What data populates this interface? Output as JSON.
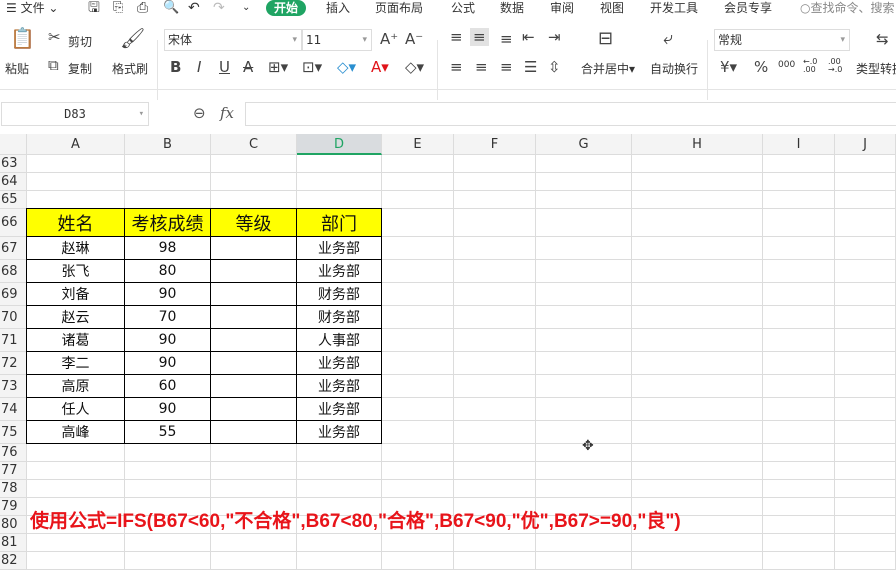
{
  "menubar": {
    "file": "文件",
    "tabs": [
      "开始",
      "插入",
      "页面布局",
      "公式",
      "数据",
      "审阅",
      "视图",
      "开发工具",
      "会员专享"
    ],
    "search_placeholder": "查找命令、搜索"
  },
  "ribbon": {
    "paste": "粘贴",
    "cut": "剪切",
    "copy": "复制",
    "format_painter": "格式刷",
    "font_name": "宋体",
    "font_size": "11",
    "merge_center": "合并居中",
    "wrap_text": "自动换行",
    "number_format": "常规",
    "type_convert": "类型转换",
    "currency": "¥",
    "percent": "%",
    "thousands": "000",
    "inc_decimal": "←.0 .00",
    "dec_decimal": ".00 →.0"
  },
  "formula_bar": {
    "cell_ref": "D83",
    "fx": "fx",
    "value": ""
  },
  "columns": [
    "A",
    "B",
    "C",
    "D",
    "E",
    "F",
    "G",
    "H",
    "I",
    "J"
  ],
  "selected_column": "D",
  "rows": [
    "63",
    "64",
    "65",
    "66",
    "67",
    "68",
    "69",
    "70",
    "71",
    "72",
    "73",
    "74",
    "75",
    "76",
    "77",
    "78",
    "79",
    "80",
    "81",
    "82"
  ],
  "table": {
    "headers": [
      "姓名",
      "考核成绩",
      "等级",
      "部门"
    ],
    "data": [
      [
        "赵琳",
        "98",
        "",
        "业务部"
      ],
      [
        "张飞",
        "80",
        "",
        "业务部"
      ],
      [
        "刘备",
        "90",
        "",
        "财务部"
      ],
      [
        "赵云",
        "70",
        "",
        "财务部"
      ],
      [
        "诸葛",
        "90",
        "",
        "人事部"
      ],
      [
        "李二",
        "90",
        "",
        "业务部"
      ],
      [
        "高原",
        "60",
        "",
        "业务部"
      ],
      [
        "任人",
        "90",
        "",
        "业务部"
      ],
      [
        "高峰",
        "55",
        "",
        "业务部"
      ]
    ]
  },
  "annotation": "使用公式=IFS(B67<60,\"不合格\",B67<80,\"合格\",B67<90,\"优\",B67>=90,\"良\")",
  "colors": {
    "accent": "#1fa463",
    "header_fill": "#ffff00",
    "annotation": "#e8141a"
  }
}
